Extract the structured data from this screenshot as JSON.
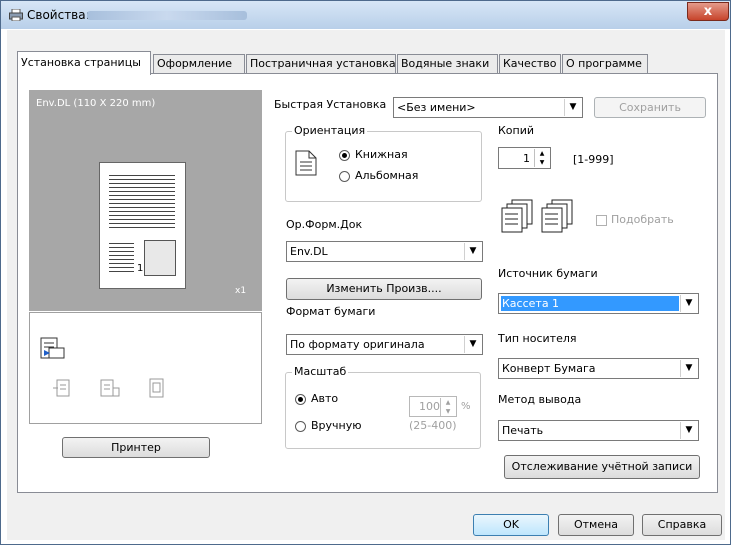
{
  "window": {
    "title": "Свойства:",
    "close_label": "x"
  },
  "tabs": [
    {
      "label": "Установка страницы"
    },
    {
      "label": "Оформление"
    },
    {
      "label": "Постраничная установка"
    },
    {
      "label": "Водяные знаки"
    },
    {
      "label": "Качество"
    },
    {
      "label": "О программе"
    }
  ],
  "preview": {
    "paper_label": "Env.DL  (110 X 220 mm)",
    "copies_badge": "x1",
    "page_number": "1"
  },
  "left": {
    "printer_button": "Принтер"
  },
  "quick_setup": {
    "label": "Быстрая Установка",
    "value": "<Без имени>",
    "save_label": "Сохранить"
  },
  "orientation": {
    "title": "Ориентация",
    "portrait": "Книжная",
    "landscape": "Альбомная",
    "selected": "portrait"
  },
  "original_size": {
    "label": "Ор.Форм.Док",
    "value": "Env.DL",
    "custom_button": "Изменить Произв...."
  },
  "paper_size": {
    "label": "Формат бумаги",
    "value": "По формату оригинала"
  },
  "zoom": {
    "title": "Масштаб",
    "auto": "Авто",
    "manual": "Вручную",
    "value": "100",
    "unit": "%",
    "range": "(25-400)",
    "selected": "auto"
  },
  "copies": {
    "label": "Копий",
    "value": "1",
    "range": "[1-999]",
    "collate_label": "Подобрать"
  },
  "paper_source": {
    "label": "Источник бумаги",
    "value": "Кассета 1"
  },
  "media_type": {
    "label": "Тип носителя",
    "value": "Конверт Бумага"
  },
  "output_method": {
    "label": "Метод вывода",
    "value": "Печать"
  },
  "account_button": "Отслеживание учётной записи",
  "footer": {
    "ok": "OK",
    "cancel": "Отмена",
    "help": "Справка"
  }
}
